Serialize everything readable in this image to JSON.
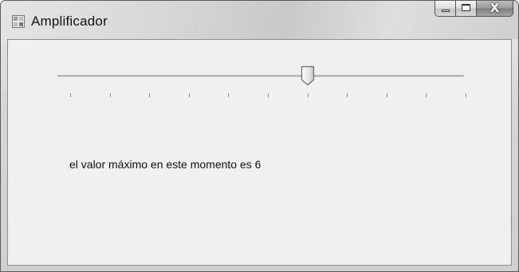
{
  "window": {
    "title": "Amplificador",
    "icon": "form-app-icon",
    "controls": {
      "minimize_icon": "minimize-icon",
      "maximize_icon": "maximize-icon",
      "close_glyph": "X"
    }
  },
  "trackbar": {
    "min": 0,
    "max": 10,
    "value": 6,
    "tick_count": 11
  },
  "status": {
    "text": "el valor máximo en este momento es 6"
  },
  "colors": {
    "client_background": "#f0f0f0",
    "titlebar": "#d6d6d6"
  }
}
